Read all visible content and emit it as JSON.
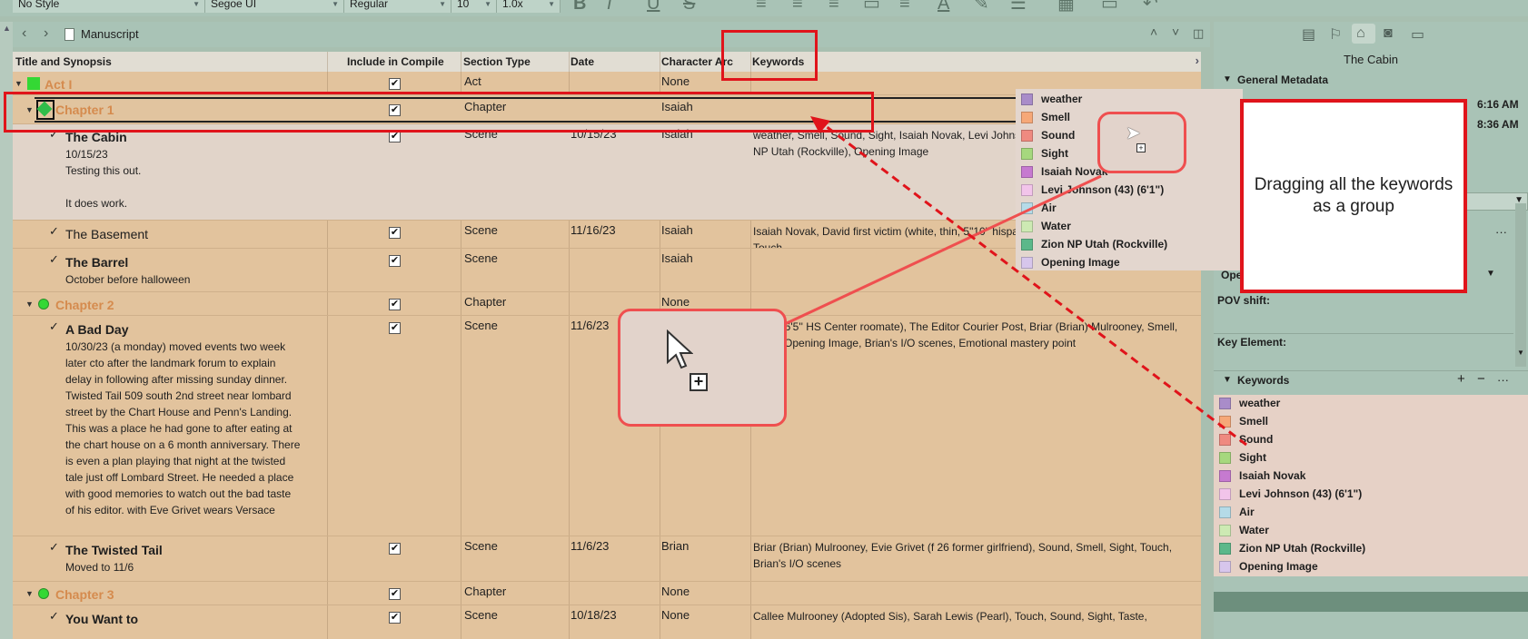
{
  "format_bar": {
    "style": "No Style",
    "font": "Segoe UI",
    "weight": "Regular",
    "size": "10",
    "spacing": "1.0x"
  },
  "nav": {
    "back": "‹",
    "forward": "›",
    "breadcrumb": "Manuscript",
    "up": "˄",
    "down": "˅"
  },
  "outline": {
    "columns": {
      "title": "Title and Synopsis",
      "compile": "Include in Compile",
      "section_type": "Section Type",
      "date": "Date",
      "character_arc": "Character Arc",
      "keywords": "Keywords"
    },
    "rows": [
      {
        "kind": "folder",
        "title": "Act I",
        "section_type": "Act",
        "date": "",
        "arc": "None",
        "keywords": "",
        "icon_color": "#34d834"
      },
      {
        "kind": "folder",
        "title": "Chapter 1",
        "section_type": "Chapter",
        "date": "",
        "arc": "Isaiah",
        "keywords": "",
        "icon_color": "#2fbd4a"
      },
      {
        "kind": "scene",
        "title": "The Cabin",
        "synopsis_lines": [
          "10/15/23",
          "Testing this out.",
          "",
          "It does work."
        ],
        "section_type": "Scene",
        "date": "10/15/23",
        "arc": "Isaiah",
        "keywords": "weather, Smell, Sound, Sight, Isaiah Novak, Levi Johnson (43) (6'1\"), Air, Water, Zion NP Utah (Rockville), Opening Image"
      },
      {
        "kind": "scene",
        "title": "The Basement",
        "synopsis_lines": [],
        "section_type": "Scene",
        "date": "11/16/23",
        "arc": "Isaiah",
        "keywords": "Isaiah Novak, David first victim (white, thin, 5\"10\" hispanic) - from chicago, Sound, Sight, Touch"
      },
      {
        "kind": "scene",
        "title": "The Barrel",
        "synopsis_lines": [
          "October before halloween"
        ],
        "section_type": "Scene",
        "date": "",
        "arc": "Isaiah",
        "keywords": ""
      },
      {
        "kind": "folder",
        "title": "Chapter 2",
        "section_type": "Chapter",
        "date": "",
        "arc": "None",
        "keywords": "",
        "icon_color": "#34d834"
      },
      {
        "kind": "scene",
        "title": "A Bad Day",
        "synopsis_lines": [
          "10/30/23 (a monday) moved events two week",
          "later cto after the landmark forum to explain",
          "delay in following after missing sunday dinner.",
          "Twisted Tail 509 south 2nd street near lombard",
          "street by the Chart House and Penn's Landing.",
          "This was a place he had gone to after eating at",
          "the chart house on a 6 month anniversary. There",
          "is even a plan playing that night at the twisted",
          "tale just off Lombard Street. He needed a place",
          "with good memories to watch out the bad taste",
          "of his editor. with Eve Grivet wears Versace"
        ],
        "section_type": "Scene",
        "date": "11/6/23",
        "arc": "",
        "keywords": "Adam 6'5'' HS Center roomate), The Editor Courier Post, Briar (Brian) Mulrooney, Smell, Sight, Opening Image, Brian's I/O scenes, Emotional mastery point"
      },
      {
        "kind": "scene",
        "title": "The Twisted Tail",
        "synopsis_lines": [
          "Moved to 11/6"
        ],
        "section_type": "Scene",
        "date": "11/6/23",
        "arc": "Brian",
        "keywords": "Briar (Brian) Mulrooney, Evie Grivet (f 26 former girlfriend), Sound, Smell, Sight, Touch, Brian's I/O scenes"
      },
      {
        "kind": "folder",
        "title": "Chapter 3",
        "section_type": "Chapter",
        "date": "",
        "arc": "None",
        "keywords": "",
        "icon_color": "#34d834"
      },
      {
        "kind": "scene",
        "title": "You Want to",
        "synopsis_lines": [],
        "section_type": "Scene",
        "date": "10/18/23",
        "arc": "None",
        "keywords": "Callee Mulrooney (Adopted Sis), Sarah Lewis (Pearl), Touch, Sound, Sight, Taste,"
      }
    ]
  },
  "inspector": {
    "title": "The Cabin",
    "general_metadata": "General Metadata",
    "created_time": "6:16 AM",
    "modified_time": "8:36 AM",
    "opening_prefix": "Ope",
    "pov_shift": "POV shift:",
    "key_element": "Key Element:",
    "keywords_header": "Keywords",
    "add": "+",
    "remove": "−",
    "more": "···"
  },
  "keywords": [
    {
      "label": "weather",
      "color": "#a98cc9"
    },
    {
      "label": "Smell",
      "color": "#f6a878"
    },
    {
      "label": "Sound",
      "color": "#ef8a80"
    },
    {
      "label": "Sight",
      "color": "#a6d87e"
    },
    {
      "label": "Isaiah Novak",
      "color": "#c67ad0"
    },
    {
      "label": "Levi Johnson (43) (6'1\")",
      "color": "#f2c4ea"
    },
    {
      "label": "Air",
      "color": "#b5dbe8"
    },
    {
      "label": "Water",
      "color": "#cdeab3"
    },
    {
      "label": "Zion NP Utah (Rockville)",
      "color": "#5cb88a"
    },
    {
      "label": "Opening Image",
      "color": "#d7c6ec"
    }
  ],
  "annotation": {
    "note": "Dragging all the keywords as a group"
  },
  "check_mark": "✓",
  "box_check": "✔"
}
